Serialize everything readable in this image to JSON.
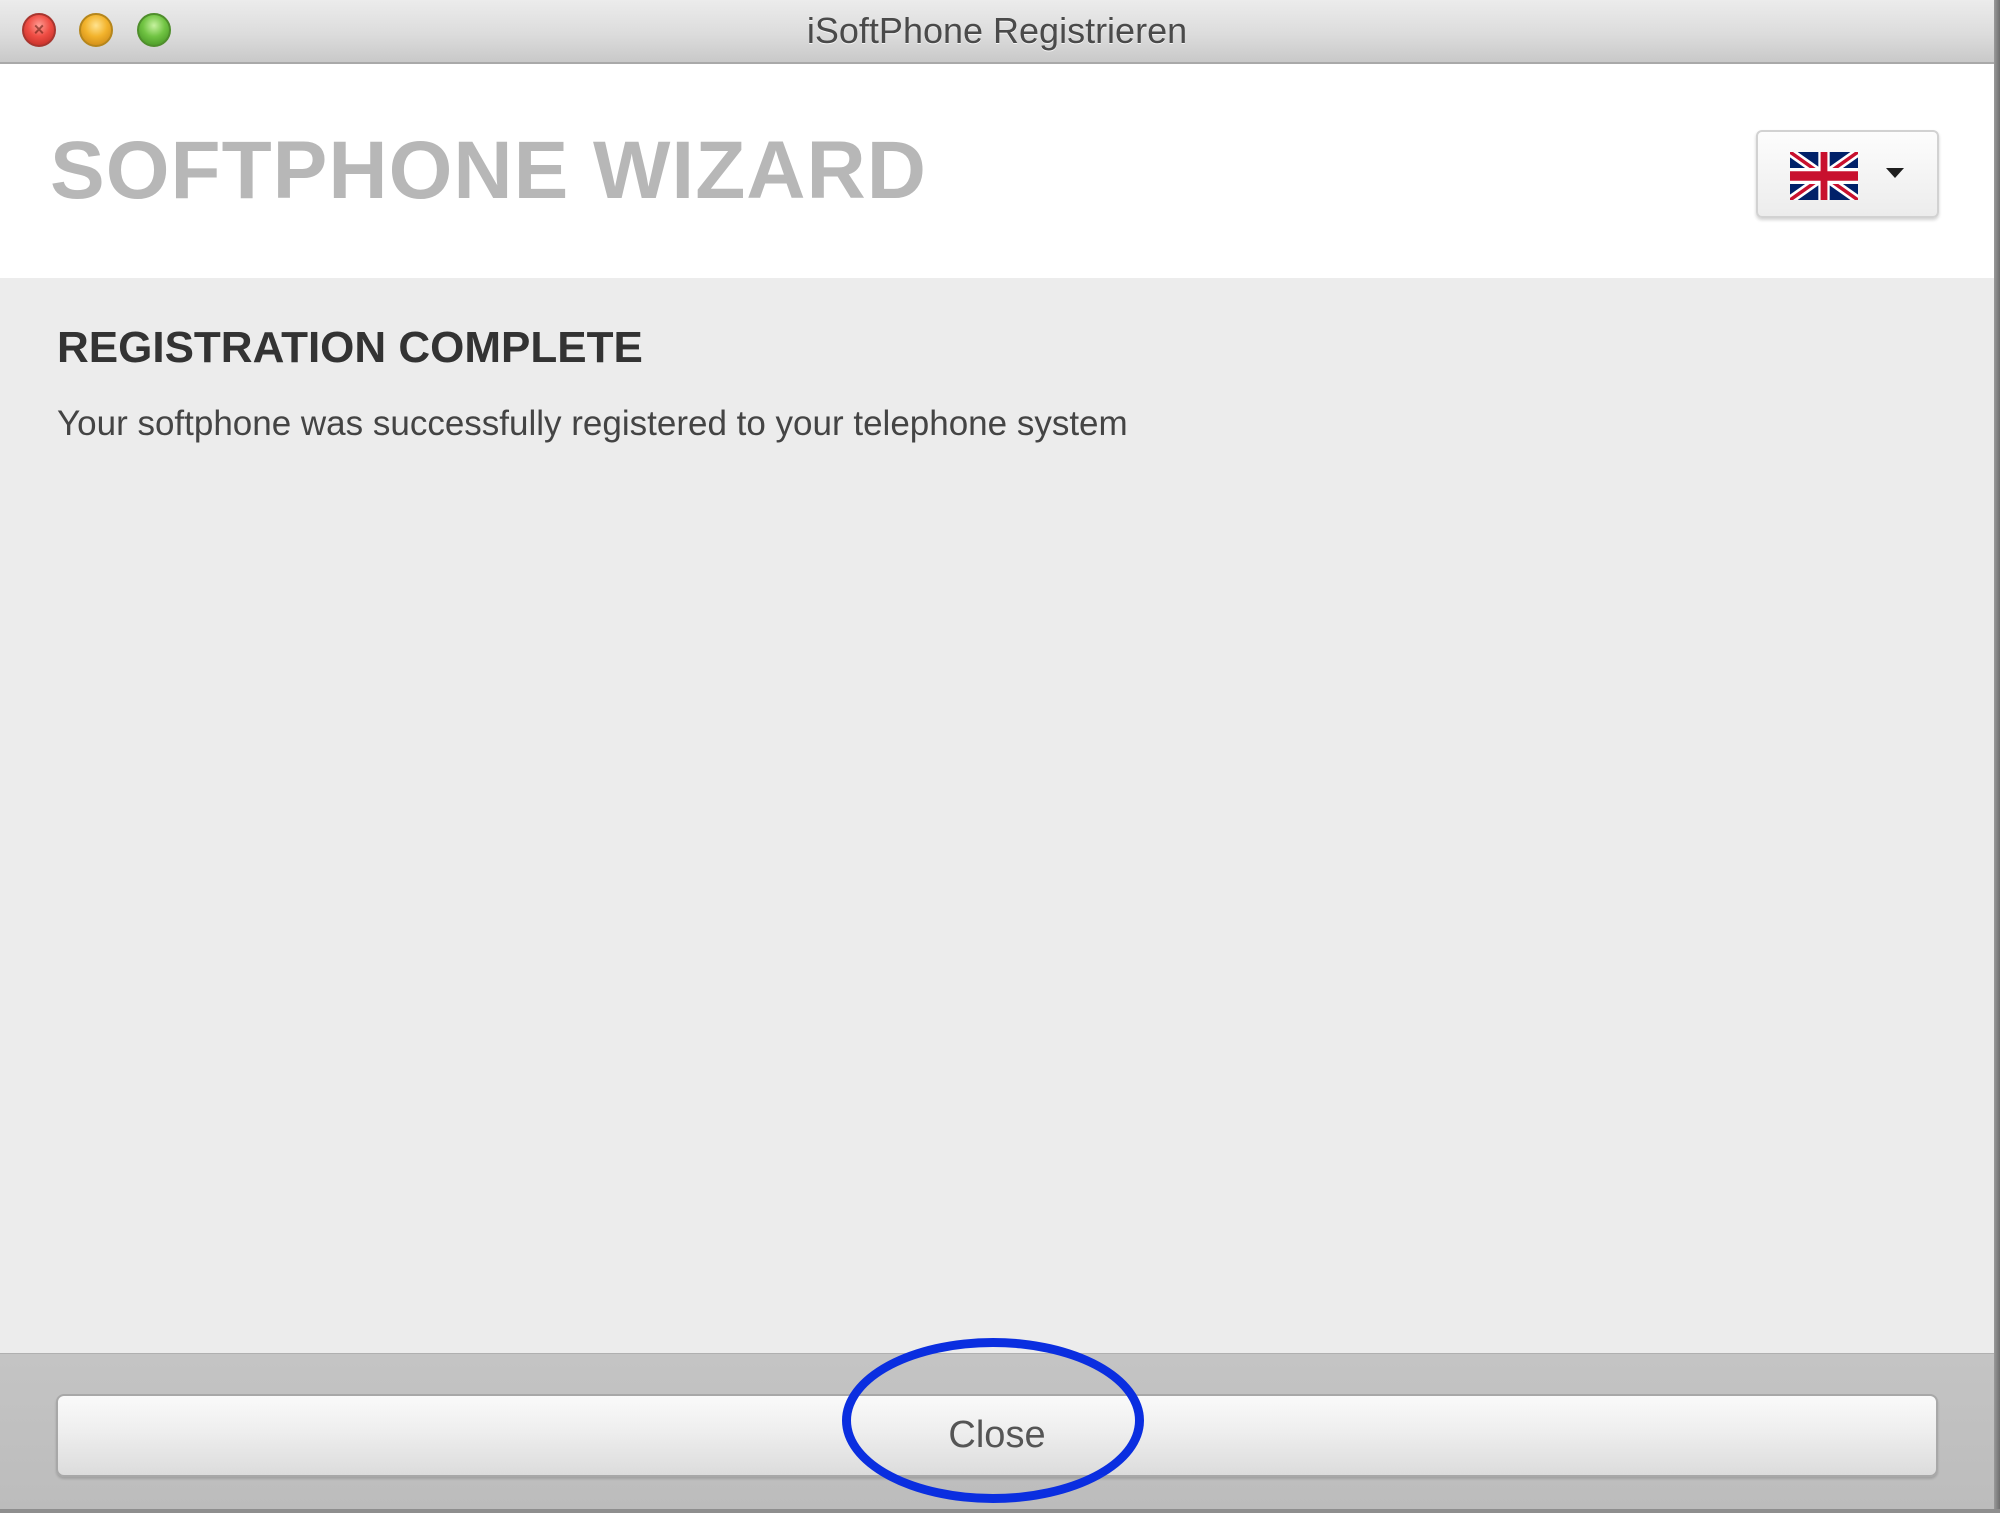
{
  "window": {
    "title": "iSoftPhone Registrieren"
  },
  "header": {
    "wizard_title": "SOFTPHONE WIZARD",
    "language_icon": "uk-flag-icon"
  },
  "content": {
    "heading": "REGISTRATION COMPLETE",
    "message": "Your softphone was successfully registered to your telephone system"
  },
  "footer": {
    "close_label": "Close"
  },
  "colors": {
    "highlight_ring": "#0a2ee0",
    "wizard_title": "#b7b7b7",
    "content_background": "#ececec"
  }
}
